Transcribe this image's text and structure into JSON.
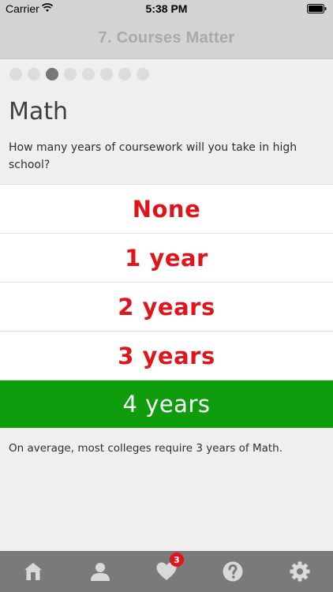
{
  "status_bar": {
    "carrier": "Carrier",
    "time": "5:38 PM"
  },
  "header": {
    "title": "7. Courses Matter"
  },
  "progress": {
    "total": 8,
    "current": 3
  },
  "subject": "Math",
  "question": "How many years of coursework will you take in high school?",
  "options": [
    {
      "label": "None",
      "selected": false
    },
    {
      "label": "1 year",
      "selected": false
    },
    {
      "label": "2 years",
      "selected": false
    },
    {
      "label": "3 years",
      "selected": false
    },
    {
      "label": "4 years",
      "selected": true
    }
  ],
  "note": "On average, most colleges require 3 years of Math.",
  "tab_bar": {
    "items": [
      {
        "icon": "home-icon"
      },
      {
        "icon": "profile-icon"
      },
      {
        "icon": "heart-icon",
        "badge": "3"
      },
      {
        "icon": "help-icon"
      },
      {
        "icon": "settings-icon"
      }
    ]
  },
  "colors": {
    "accent_red": "#e0151b",
    "selected_green": "#0f9d0e",
    "header_bg": "#d3d3d4",
    "tab_bar_bg": "#7a7a7c"
  }
}
